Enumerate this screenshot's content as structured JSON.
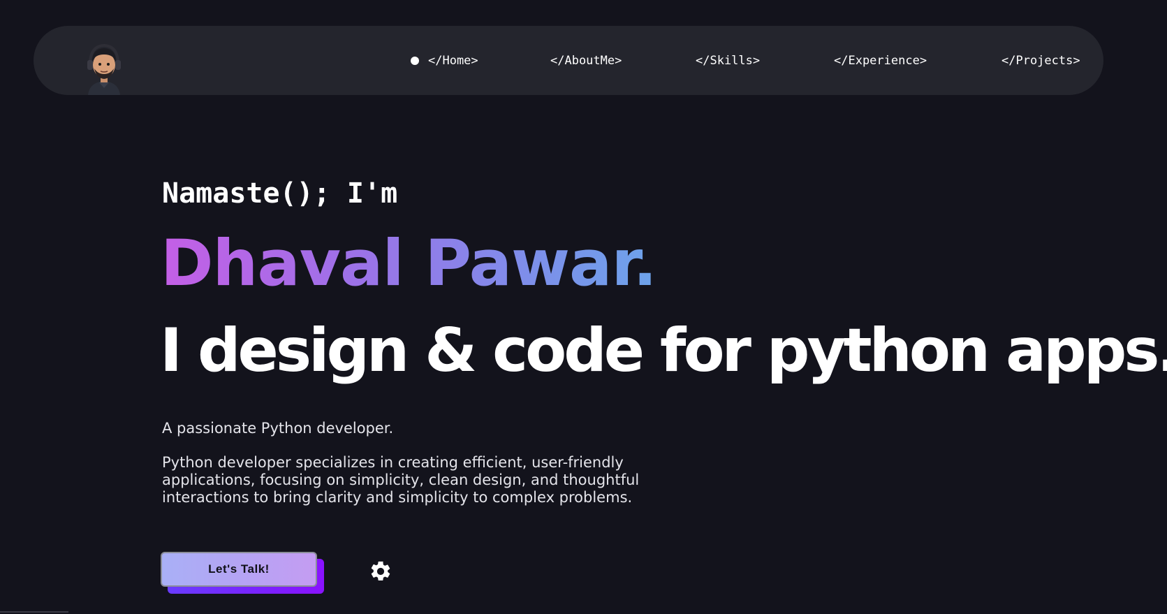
{
  "nav": {
    "avatar_icon": "memoji-avatar-with-headphones",
    "links": [
      {
        "label": "</Home>",
        "active": true
      },
      {
        "label": "</AboutMe>"
      },
      {
        "label": "</Skills>"
      },
      {
        "label": "</Experience>"
      },
      {
        "label": "</Projects>"
      }
    ]
  },
  "hero": {
    "greeting": "Namaste(); I'm",
    "name": "Dhaval Pawar.",
    "headline": "I design & code for python apps.",
    "tagline": "A passionate Python developer.",
    "description": "Python developer specializes in creating efficient, user-friendly applications, focusing on simplicity, clean design, and thoughtful interactions to bring clarity and simplicity to complex problems.",
    "cta_label": "Let's Talk!",
    "settings_icon": "gear-icon"
  },
  "colors": {
    "background": "#13131c",
    "navbar": "#24252d",
    "name_gradient": [
      "#c45fe6",
      "#6da3ea"
    ],
    "cta_gradient": [
      "#a9b0f6",
      "#c49cf2"
    ],
    "cta_shadow": "#7a22ff"
  }
}
